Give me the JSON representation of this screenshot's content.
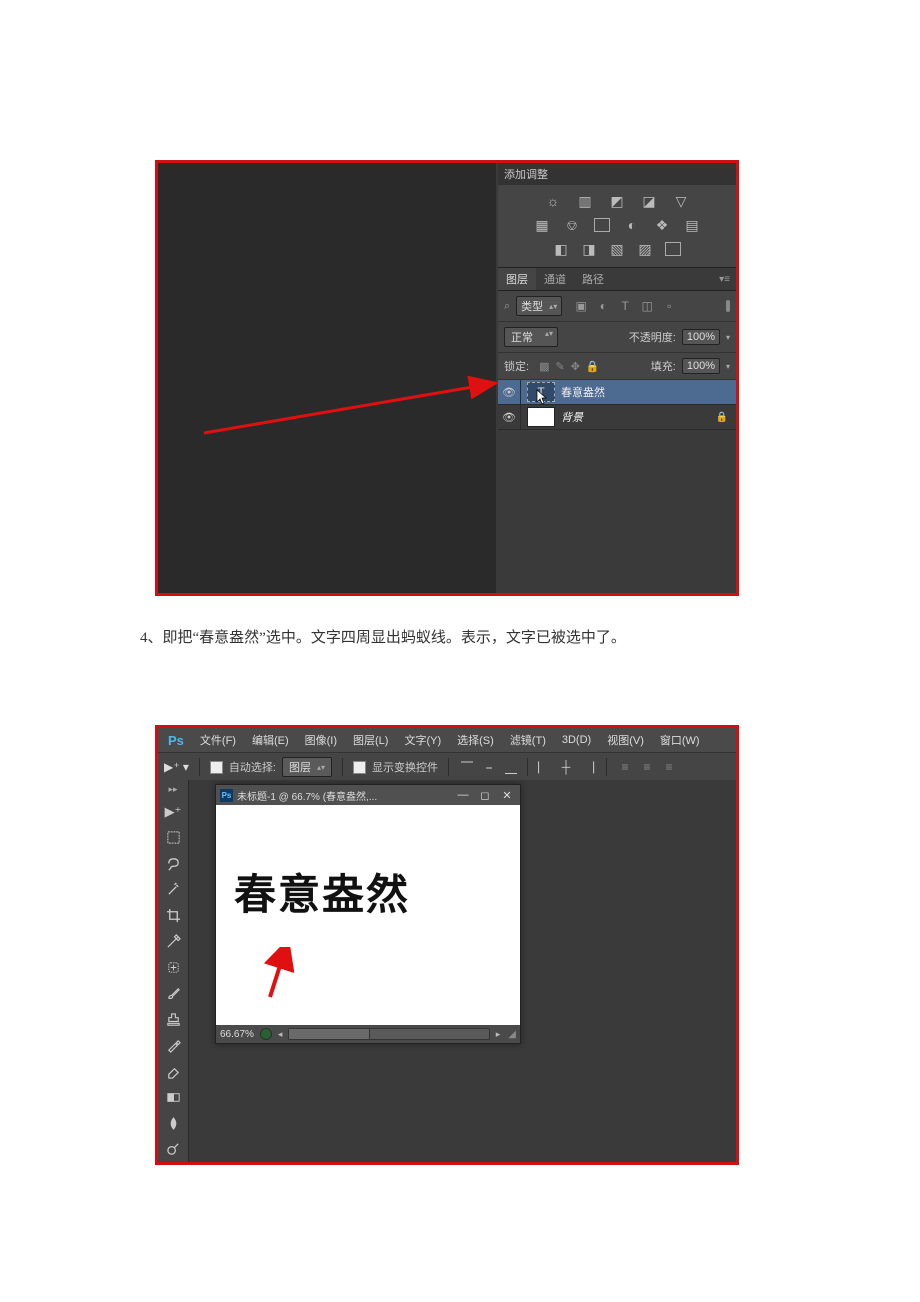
{
  "figure1": {
    "adjustments_header": "添加调整",
    "panel_tabs": {
      "layers": "图层",
      "channels": "通道",
      "paths": "路径"
    },
    "filter": {
      "label": "类型"
    },
    "blend": {
      "mode": "正常",
      "opacity_label": "不透明度:",
      "opacity": "100%"
    },
    "lock": {
      "label": "锁定:",
      "fill_label": "填充:",
      "fill": "100%"
    },
    "layers": [
      {
        "name": "春意盎然",
        "type": "text",
        "selected": true
      },
      {
        "name": "背景",
        "type": "background",
        "locked": true
      }
    ]
  },
  "caption": "4、即把“春意盎然”选中。文字四周显出蚂蚁线。表示，文字已被选中了。",
  "figure2": {
    "menu": {
      "file": "文件(F)",
      "edit": "编辑(E)",
      "image": "图像(I)",
      "layer": "图层(L)",
      "type": "文字(Y)",
      "select": "选择(S)",
      "filter": "滤镜(T)",
      "threeD": "3D(D)",
      "view": "视图(V)",
      "window": "窗口(W)"
    },
    "options": {
      "auto_select": "自动选择:",
      "target": "图层",
      "show_transform": "显示变换控件"
    },
    "doc": {
      "title": "未标题-1 @ 66.7% (春意盎然,...",
      "text": "春意盎然",
      "zoom": "66.67%"
    }
  }
}
